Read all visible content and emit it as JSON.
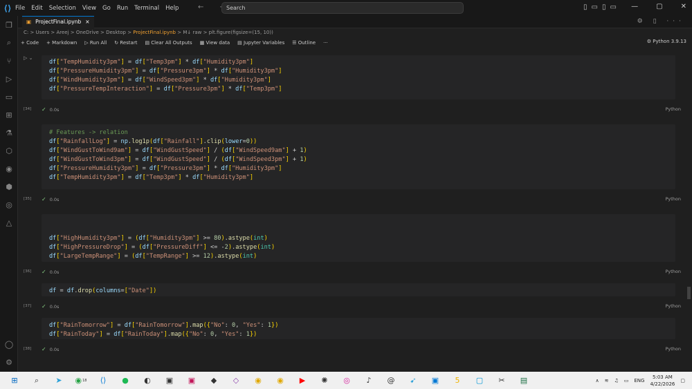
{
  "menu": [
    "File",
    "Edit",
    "Selection",
    "View",
    "Go",
    "Run",
    "Terminal",
    "Help"
  ],
  "search": {
    "label": "Search"
  },
  "tab": {
    "label": "ProjectFinal.ipynb",
    "close": "×"
  },
  "breadcrumb": {
    "text": "C: > Users > Areej > OneDrive > Desktop > ",
    "file": "ProjectFinal.ipynb",
    "rest": " > M↓ raw > ",
    "sym": "plt.figure(figsize=(15, 10))"
  },
  "toolbar": {
    "code": "+ Code",
    "markdown": "+ Markdown",
    "run_all": "▷ Run All",
    "restart": "↻ Restart",
    "clear": "▤ Clear All Outputs",
    "view_data": "▦ View data",
    "jupyter_vars": "▤ Jupyter Variables",
    "outline": "☰ Outline",
    "more": "···",
    "kernel": "⚙ Python 3.9.13"
  },
  "cells": [
    {
      "exec": "[34]",
      "time": "0.0s",
      "lang": "Python",
      "lines": [
        "df[\"TempHumidity3pm\"] = df[\"Temp3pm\"] * df[\"Humidity3pm\"]",
        "df[\"PressureHumidity3pm\"] = df[\"Pressure3pm\"] * df[\"Humidity3pm\"]",
        "df[\"WindHumidity3pm\"] = df[\"WindSpeed3pm\"] * df[\"Humidity3pm\"]",
        "df[\"PressureTempInteraction\"] = df[\"Pressure3pm\"] * df[\"Temp3pm\"]"
      ]
    },
    {
      "exec": "[35]",
      "time": "0.0s",
      "lang": "Python",
      "lines": [
        "# Features -> relation",
        "df[\"RainfallLog\"] = np.log1p(df[\"Rainfall\"].clip(lower=0))",
        "df[\"WindGustToWind9am\"] = df[\"WindGustSpeed\"] / (df[\"WindSpeed9am\"] + 1)",
        "df[\"WindGustToWind3pm\"] = df[\"WindGustSpeed\"] / (df[\"WindSpeed3pm\"] + 1)",
        "df[\"PressureHumidity3pm\"] = df[\"Pressure3pm\"] * df[\"Humidity3pm\"]",
        "df[\"TempHumidity3pm\"] = df[\"Temp3pm\"] * df[\"Humidity3pm\"]"
      ]
    },
    {
      "exec": "[36]",
      "time": "0.0s",
      "lang": "Python",
      "lines": [
        "",
        "df[\"HighHumidity3pm\"] = (df[\"Humidity3pm\"] >= 80).astype(int)",
        "df[\"HighPressureDrop\"] = (df[\"PressureDiff\"] <= -2).astype(int)",
        "df[\"LargeTempRange\"] = (df[\"TempRange\"] >= 12).astype(int)"
      ]
    },
    {
      "exec": "[37]",
      "time": "0.0s",
      "lang": "Python",
      "lines": [
        "df = df.drop(columns=[\"Date\"])"
      ]
    },
    {
      "exec": "[38]",
      "time": "0.0s",
      "lang": "Python",
      "lines": [
        "df[\"RainTomorrow\"] = df[\"RainTomorrow\"].map({\"No\": 0, \"Yes\": 1})",
        "df[\"RainToday\"] = df[\"RainToday\"].map({\"No\": 0, \"Yes\": 1})"
      ]
    }
  ],
  "taskbar": {
    "lang": "ENG",
    "time": "5:03 AM",
    "date": "4/22/2026",
    "badge": "18"
  }
}
